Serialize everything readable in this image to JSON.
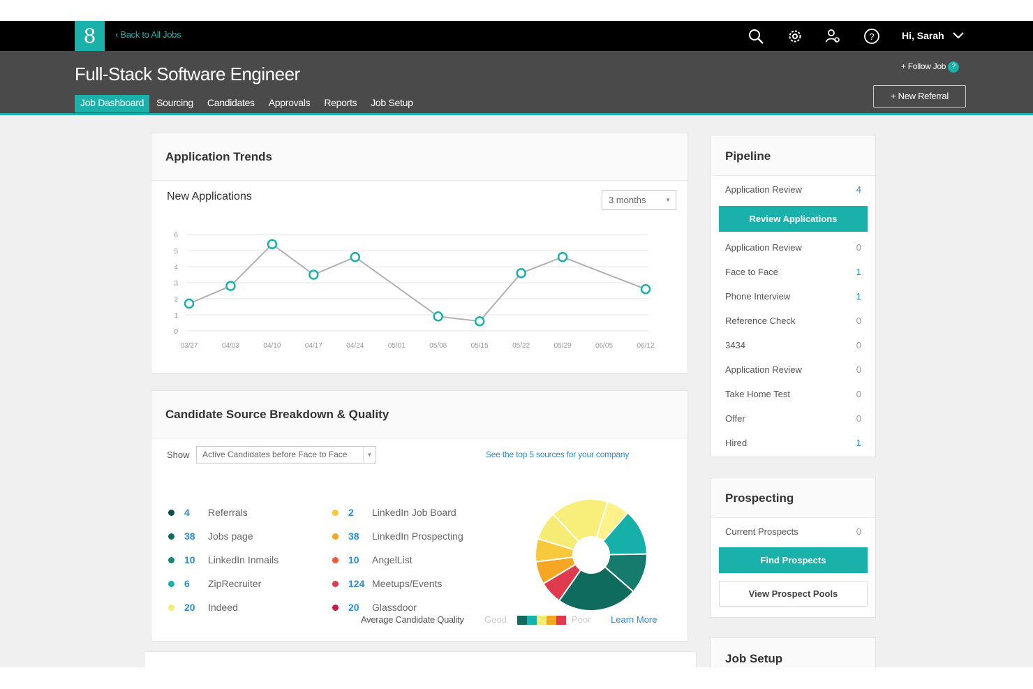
{
  "topbar": {
    "logo_glyph": "8",
    "back_label": "Back to All Jobs",
    "user_greeting": "Hi, Sarah",
    "icons": [
      "search-icon",
      "gear-icon",
      "users-icon",
      "help-icon",
      "chevron-down-icon"
    ]
  },
  "header": {
    "title": "Full-Stack Software Engineer",
    "follow_label": "+ Follow Job",
    "follow_badge": "?",
    "new_referral_label": "+ New Referral",
    "tabs": [
      {
        "label": "Job Dashboard",
        "active": true
      },
      {
        "label": "Sourcing"
      },
      {
        "label": "Candidates"
      },
      {
        "label": "Approvals"
      },
      {
        "label": "Reports"
      },
      {
        "label": "Job Setup"
      }
    ]
  },
  "trends": {
    "title": "Application Trends",
    "subtitle": "New Applications",
    "range_value": "3 months"
  },
  "chart_data": {
    "type": "line",
    "x": [
      "03/27",
      "04/03",
      "04/10",
      "04/17",
      "04/24",
      "05/01",
      "05/08",
      "05/15",
      "05/22",
      "05/29",
      "06/05",
      "06/12"
    ],
    "series": [
      {
        "values": [
          1.7,
          2.8,
          5.4,
          3.5,
          4.6,
          0.9,
          0.6,
          3.6,
          4.6,
          2.6
        ]
      }
    ],
    "point_dates": [
      "03/27",
      "04/03",
      "04/10",
      "04/17",
      "04/24",
      "05/08",
      "05/15",
      "05/22",
      "05/29",
      "06/12"
    ],
    "yticks": [
      "0",
      "1",
      "2",
      "3",
      "4",
      "5",
      "6"
    ],
    "ylim": [
      0,
      6
    ],
    "colors": {
      "line": "#b0b0b0",
      "point": "#1ab1ab",
      "grid": "#e6e6e6"
    }
  },
  "sources": {
    "title": "Candidate Source Breakdown & Quality",
    "show_label": "Show",
    "filter_value": "Active Candidates before Face to Face",
    "top_link": "See the top 5 sources for your company",
    "left": [
      {
        "count": "4",
        "label": "Referrals",
        "color": "#0e4f47"
      },
      {
        "count": "38",
        "label": "Jobs page",
        "color": "#0f6b5e"
      },
      {
        "count": "10",
        "label": "LinkedIn Inmails",
        "color": "#14877a"
      },
      {
        "count": "6",
        "label": "ZipRecruiter",
        "color": "#16b3ad"
      },
      {
        "count": "20",
        "label": "Indeed",
        "color": "#f6ec74"
      }
    ],
    "right": [
      {
        "count": "2",
        "label": "LinkedIn Job Board",
        "color": "#f7c93b"
      },
      {
        "count": "38",
        "label": "LinkedIn Prospecting",
        "color": "#f5a623"
      },
      {
        "count": "10",
        "label": "AngelList",
        "color": "#ef5a3a"
      },
      {
        "count": "124",
        "label": "Meetups/Events",
        "color": "#e03a4e"
      },
      {
        "count": "20",
        "label": "Glassdoor",
        "color": "#c81d3c"
      }
    ],
    "quality_label": "Average Candidate Quality",
    "good_label": "Good",
    "poor_label": "Poor",
    "learn_more": "Learn More",
    "scale_colors": [
      "#0f6b5e",
      "#16b3ad",
      "#f6ec74",
      "#f5a623",
      "#e03a4e"
    ]
  },
  "donut": {
    "rings": [
      {
        "name": "outer",
        "slices": [
          {
            "value": 10,
            "color": "#f7ef7a"
          },
          {
            "value": 4,
            "color": "#fff28a"
          },
          {
            "value": 8,
            "color": "#17b0a8"
          },
          {
            "value": 7,
            "color": "#147b6d"
          },
          {
            "value": 14,
            "color": "#0f6b5e"
          },
          {
            "value": 4,
            "color": "#e03a4e"
          },
          {
            "value": 4,
            "color": "#f5a623"
          },
          {
            "value": 4,
            "color": "#f7c93b"
          },
          {
            "value": 5,
            "color": "#f6ec74"
          }
        ]
      }
    ]
  },
  "pipeline": {
    "title": "Pipeline",
    "top_row": {
      "label": "Application Review",
      "count": "4"
    },
    "review_button": "Review Applications",
    "rows": [
      {
        "label": "Application Review",
        "count": "0"
      },
      {
        "label": "Face to Face",
        "count": "1"
      },
      {
        "label": "Phone Interview",
        "count": "1"
      },
      {
        "label": "Reference Check",
        "count": "0"
      },
      {
        "label": "3434",
        "count": "0"
      },
      {
        "label": "Application Review",
        "count": "0"
      },
      {
        "label": "Take Home Test",
        "count": "0"
      },
      {
        "label": "Offer",
        "count": "0"
      },
      {
        "label": "Hired",
        "count": "1"
      }
    ]
  },
  "prospecting": {
    "title": "Prospecting",
    "row": {
      "label": "Current Prospects",
      "count": "0"
    },
    "find_button": "Find Prospects",
    "pools_button": "View Prospect Pools"
  },
  "job_setup": {
    "title": "Job Setup"
  }
}
